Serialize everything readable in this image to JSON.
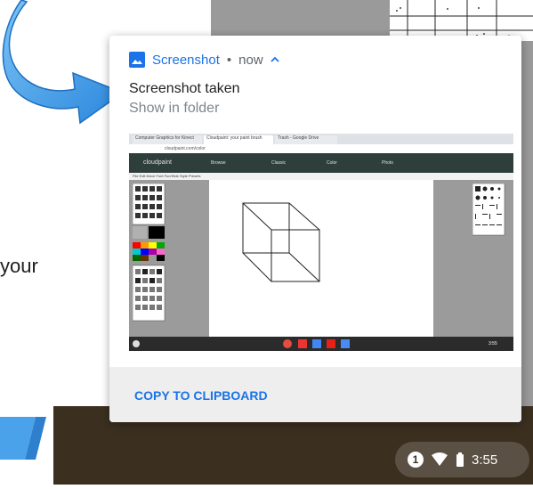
{
  "background": {
    "partial_text": "your"
  },
  "notification": {
    "app_name": "Screenshot",
    "separator": "•",
    "time": "now",
    "title": "Screenshot taken",
    "subtitle": "Show in folder",
    "action_label": "COPY TO CLIPBOARD",
    "icons": {
      "app": "image-icon",
      "expand": "chevron-up-icon"
    }
  },
  "thumbnail": {
    "tabs": [
      "Computer Graphics for Kinect",
      "Cloudpaint: your paint brush",
      "Trash - Google Drive"
    ],
    "address": "cloudpaint.com/color",
    "app_logo": "cloudpaint",
    "nav": [
      "Browse",
      "Classic",
      "Color",
      "Photo"
    ],
    "menu": "File  Edit  Move  Font  Fun/Hide  Style  Presets",
    "clock": "3:55"
  },
  "tray": {
    "notification_count": "1",
    "time": "3:55",
    "icons": [
      "wifi-icon",
      "battery-icon"
    ]
  },
  "colors": {
    "accent": "#1a73e8",
    "shelf": "#3b2f20",
    "arrow": "#3d9be9"
  }
}
